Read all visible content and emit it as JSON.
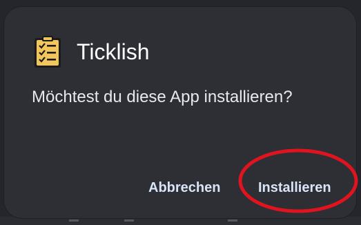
{
  "dialog": {
    "app_name": "Ticklish",
    "message": "Möchtest du diese App installieren?",
    "cancel_label": "Abbrechen",
    "install_label": "Installieren",
    "app_icon": "clipboard-checklist-icon"
  },
  "colors": {
    "dialog_background": "#2d2f34",
    "button_text": "#d9e4f7",
    "annotation": "#e0141e",
    "icon_fill": "#f2c65b"
  }
}
